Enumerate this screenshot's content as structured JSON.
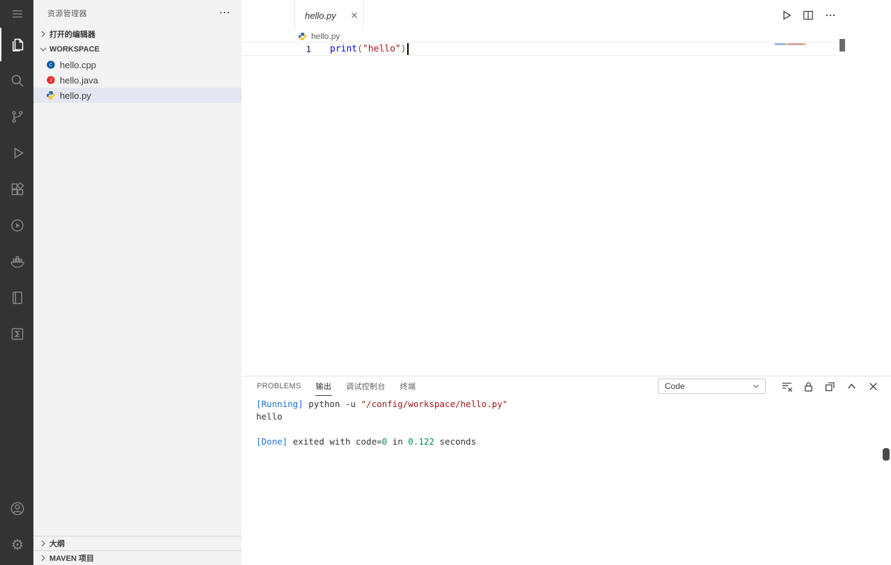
{
  "activity_bar": {
    "background": "#333333",
    "icon_color": "#858585",
    "active_icon_color": "#ffffff",
    "items": [
      {
        "icon": "menu-icon"
      },
      {
        "icon": "explorer-icon",
        "active": true
      },
      {
        "icon": "search-icon"
      },
      {
        "icon": "source-control-icon"
      },
      {
        "icon": "run-debug-icon"
      },
      {
        "icon": "extensions-icon"
      },
      {
        "icon": "run-circle-icon"
      },
      {
        "icon": "docker-icon"
      },
      {
        "icon": "notebook-icon"
      },
      {
        "icon": "math-icon"
      }
    ],
    "bottom_items": [
      {
        "icon": "account-icon"
      },
      {
        "icon": "settings-gear-icon"
      }
    ]
  },
  "sidebar": {
    "title": "资源管理器",
    "more_label": "⋯",
    "open_editors_label": "打开的编辑器",
    "workspace_label": "WORKSPACE",
    "files": [
      {
        "name": "hello.cpp",
        "icon": "cpp-file-icon"
      },
      {
        "name": "hello.java",
        "icon": "java-file-icon"
      },
      {
        "name": "hello.py",
        "icon": "python-file-icon",
        "selected": true
      }
    ],
    "outline_label": "大纲",
    "maven_label": "MAVEN 项目",
    "selection_color": "#e4e6f1"
  },
  "editor": {
    "tab": {
      "label": "hello.py",
      "preview": true
    },
    "action_icons": [
      "run-icon",
      "split-editor-icon",
      "more-actions-icon"
    ],
    "breadcrumb": {
      "icon": "python-file-icon",
      "file": "hello.py"
    },
    "code": {
      "line_number": "1",
      "tokens": [
        {
          "text": "print",
          "color": "#0000ff"
        },
        {
          "text": "(",
          "color": "#795e26"
        },
        {
          "text": "\"hello\"",
          "color": "#a31515"
        },
        {
          "text": ")",
          "color": "#795e26"
        }
      ]
    }
  },
  "panel": {
    "tabs": [
      {
        "label": "PROBLEMS",
        "active": false
      },
      {
        "label": "输出",
        "active": true
      },
      {
        "label": "调试控制台",
        "active": false
      },
      {
        "label": "终端",
        "active": false
      }
    ],
    "channel_select": {
      "value": "Code"
    },
    "action_icons": [
      "clear-output-icon",
      "lock-icon",
      "open-in-editor-icon",
      "maximize-panel-icon",
      "close-panel-icon"
    ],
    "output_lines": [
      {
        "segments": [
          {
            "text": "[Running] ",
            "color": "#2472c8"
          },
          {
            "text": "python -u ",
            "color": "#333333"
          },
          {
            "text": "\"/config/workspace/hello.py\"",
            "color": "#a31515"
          }
        ]
      },
      {
        "segments": [
          {
            "text": "hello",
            "color": "#333333"
          }
        ]
      },
      {
        "segments": []
      },
      {
        "segments": [
          {
            "text": "[Done] ",
            "color": "#2472c8"
          },
          {
            "text": "exited with code=",
            "color": "#333333"
          },
          {
            "text": "0",
            "color": "#098658"
          },
          {
            "text": " in ",
            "color": "#333333"
          },
          {
            "text": "0.122",
            "color": "#098658"
          },
          {
            "text": " seconds",
            "color": "#333333"
          }
        ]
      }
    ]
  }
}
